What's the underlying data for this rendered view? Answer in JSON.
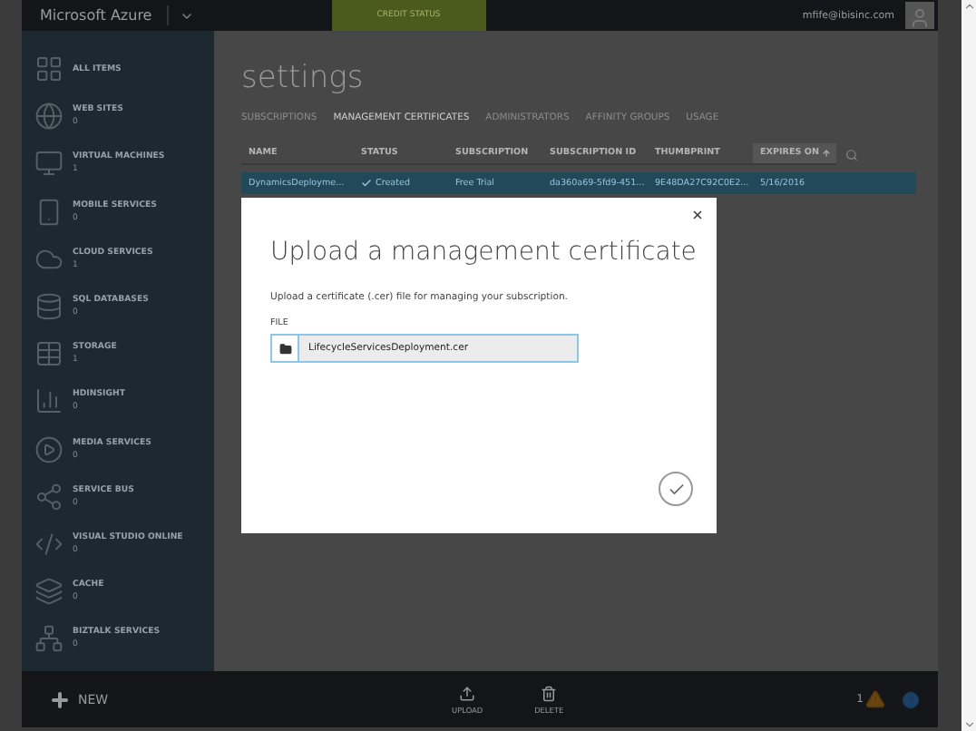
{
  "top_bar": {
    "brand": "Microsoft Azure",
    "credit_status": "CREDIT STATUS",
    "user": "mfife@ibisinc.com"
  },
  "sidebar": {
    "items": [
      {
        "kind": "grid",
        "name": "ALL ITEMS"
      },
      {
        "kind": "globe",
        "name": "WEB SITES",
        "count": "0"
      },
      {
        "kind": "monitor",
        "name": "VIRTUAL MACHINES",
        "count": "1"
      },
      {
        "kind": "phone",
        "name": "MOBILE SERVICES",
        "count": "0"
      },
      {
        "kind": "cloud",
        "name": "CLOUD SERVICES",
        "count": "1"
      },
      {
        "kind": "database",
        "name": "SQL DATABASES",
        "count": "0"
      },
      {
        "kind": "table",
        "name": "STORAGE",
        "count": "1"
      },
      {
        "kind": "chart",
        "name": "HDINSIGHT",
        "count": "0"
      },
      {
        "kind": "media",
        "name": "MEDIA SERVICES",
        "count": "0"
      },
      {
        "kind": "bus",
        "name": "SERVICE BUS",
        "count": "0"
      },
      {
        "kind": "code",
        "name": "VISUAL STUDIO ONLINE",
        "count": "0"
      },
      {
        "kind": "cache",
        "name": "CACHE",
        "count": "0"
      },
      {
        "kind": "network",
        "name": "BIZTALK SERVICES",
        "count": "0"
      }
    ]
  },
  "page": {
    "title": "settings",
    "tabs": [
      {
        "label": "SUBSCRIPTIONS",
        "selected": false
      },
      {
        "label": "MANAGEMENT CERTIFICATES",
        "selected": true
      },
      {
        "label": "ADMINISTRATORS",
        "selected": false
      },
      {
        "label": "AFFINITY GROUPS",
        "selected": false
      },
      {
        "label": "USAGE",
        "selected": false
      }
    ],
    "table": {
      "columns": [
        {
          "label": "NAME",
          "sorted": false
        },
        {
          "label": "STATUS",
          "sorted": false
        },
        {
          "label": "SUBSCRIPTION",
          "sorted": false
        },
        {
          "label": "SUBSCRIPTION ID",
          "sorted": false
        },
        {
          "label": "THUMBPRINT",
          "sorted": false
        },
        {
          "label": "EXPIRES ON",
          "sorted": true
        }
      ],
      "rows": [
        {
          "selected": true,
          "cells": [
            "DynamicsDeployme...",
            "Created",
            "Free Trial",
            "da360a69-5fd9-451...",
            "9E48DA27C92C0E2...",
            "5/16/2016"
          ]
        }
      ]
    }
  },
  "dialog": {
    "title": "Upload a management certificate",
    "description": "Upload a certificate (.cer) file for managing your subscription.",
    "field_label": "FILE",
    "file_value": "LifecycleServicesDeployment.cer"
  },
  "bottom_bar": {
    "new_label": "NEW",
    "actions": [
      {
        "kind": "upload",
        "label": "UPLOAD"
      },
      {
        "kind": "delete",
        "label": "DELETE"
      }
    ],
    "alert_count": "1"
  }
}
